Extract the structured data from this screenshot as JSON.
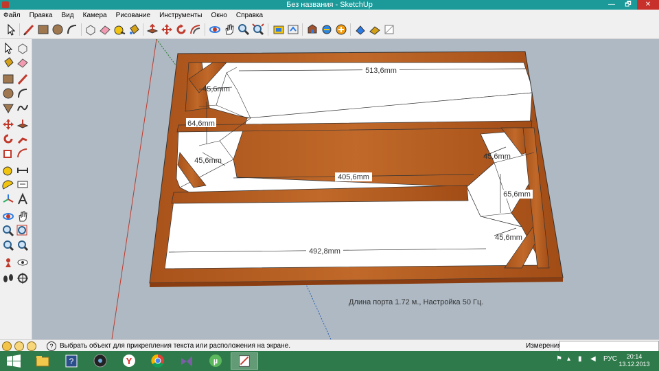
{
  "window": {
    "title": "Без названия - SketchUp"
  },
  "window_controls": {
    "minimize": "—",
    "maximize": "🗗",
    "close": "✕"
  },
  "menu": [
    "Файл",
    "Правка",
    "Вид",
    "Камера",
    "Рисование",
    "Инструменты",
    "Окно",
    "Справка"
  ],
  "toolbar_icons": [
    "select-tool-icon",
    "line-tool-icon",
    "rectangle-tool-icon",
    "circle-tool-icon",
    "arc-tool-icon",
    "make-component-icon",
    "eraser-icon",
    "tape-measure-icon",
    "paint-bucket-icon",
    "push-pull-icon",
    "move-icon",
    "rotate-icon",
    "offset-icon",
    "orbit-icon",
    "pan-icon",
    "zoom-icon",
    "zoom-extents-icon",
    "3d-warehouse-icon",
    "share-model-icon",
    "get-models-icon",
    "component-icon",
    "extension-icon",
    "layout-icon",
    "style-icon",
    "shadow-icon"
  ],
  "dimensions": {
    "top_length": "513,6mm",
    "top_left_angle": "45,6mm",
    "left_height": "64,6mm",
    "left_bottom_angle": "45,6mm",
    "middle_length": "405,6mm",
    "right_top_angle": "45,6mm",
    "right_height": "65,6mm",
    "right_bottom_angle": "45,6mm",
    "bottom_length": "492,8mm"
  },
  "annotation": "Длина порта 1.72 м., Настройка 50 Гц.",
  "status": {
    "hint": "Выбрать объект для прикрепления текста или расположения на экране.",
    "help_glyph": "?",
    "measurements_label": "Измерения",
    "measurements_value": ""
  },
  "tray": {
    "language": "РУС",
    "time": "20:14",
    "date": "13.12.2013"
  },
  "colors": {
    "wood": "#b55a1a",
    "panel": "#ffffff",
    "background": "#aeb9c3",
    "titlebar": "#1c9a9a",
    "taskbar": "#2f7a4a"
  }
}
